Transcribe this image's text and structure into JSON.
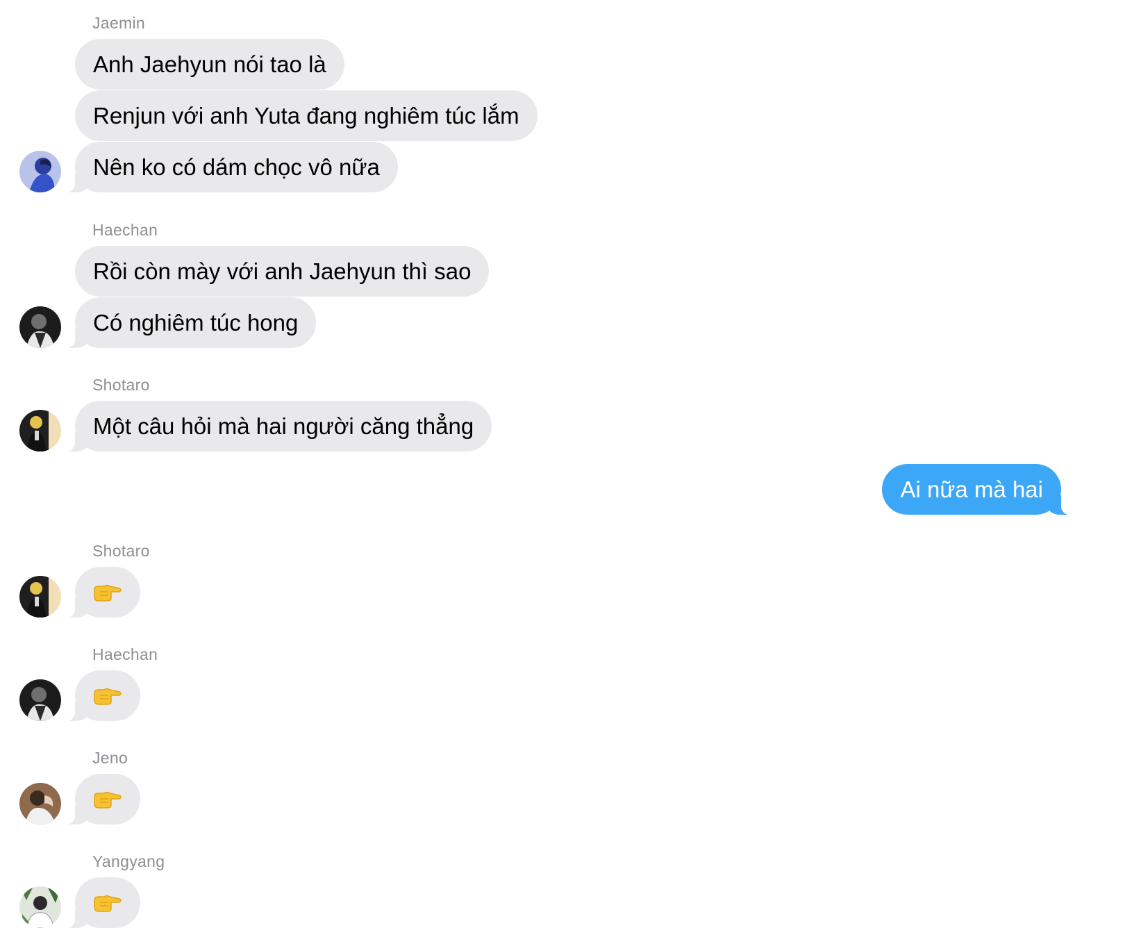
{
  "conversation": {
    "groups": [
      {
        "sender": "Jaemin",
        "messages": [
          "Anh Jaehyun nói tao là",
          "Renjun với anh Yuta đang nghiêm túc lắm",
          "Nên ko có dám chọc vô nữa"
        ],
        "avatar": "jaemin-avatar"
      },
      {
        "sender": "Haechan",
        "messages": [
          "Rồi còn mày với anh Jaehyun thì sao",
          "Có nghiêm túc hong"
        ],
        "avatar": "haechan-avatar"
      },
      {
        "sender": "Shotaro",
        "messages": [
          "Một câu hỏi mà hai người căng thẳng"
        ],
        "avatar": "shotaro-avatar"
      },
      {
        "sender": "Shotaro",
        "messages": [],
        "emoji": "pointing-right-hand-icon",
        "avatar": "shotaro-avatar"
      },
      {
        "sender": "Haechan",
        "messages": [],
        "emoji": "pointing-right-hand-icon",
        "avatar": "haechan-avatar"
      },
      {
        "sender": "Jeno",
        "messages": [],
        "emoji": "pointing-right-hand-icon",
        "avatar": "jeno-avatar"
      },
      {
        "sender": "Yangyang",
        "messages": [],
        "emoji": "pointing-right-hand-icon",
        "avatar": "yangyang-avatar"
      }
    ],
    "outgoing": {
      "text": "Ai nữa mà hai"
    }
  },
  "colors": {
    "incoming_bubble": "#e9e9eb",
    "outgoing_bubble": "#3da7f7",
    "sender_name": "#8e8e93",
    "background": "#ffffff"
  }
}
